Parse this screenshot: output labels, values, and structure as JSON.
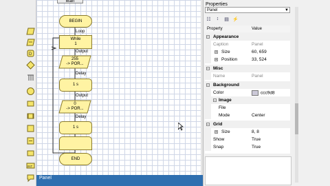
{
  "document_tab": "Main",
  "status_text": "Panel",
  "flowchart": {
    "begin": "BEGIN",
    "loop_label": "Loop",
    "while_line1": "While",
    "while_line2": "1",
    "output1_label": "Output",
    "output1_line1": "255",
    "output1_line2": "-> POR...",
    "delay1_label": "Delay",
    "delay1_value": "1 s",
    "output2_label": "Output",
    "output2_line1": "0",
    "output2_line2": "-> POR...",
    "delay2_label": "Delay",
    "delay2_value": "1 s",
    "end": "END"
  },
  "properties": {
    "title": "Properties",
    "selected_object": "Panel",
    "columns": {
      "property": "Property",
      "value": "Value"
    },
    "rows": [
      {
        "type": "cat",
        "name": "Appearance"
      },
      {
        "type": "field",
        "name": "Caption",
        "value": "Panel"
      },
      {
        "type": "sub",
        "name": "Size",
        "value": "60, 659"
      },
      {
        "type": "sub",
        "name": "Position",
        "value": "33, 524"
      },
      {
        "type": "cat",
        "name": "Misc"
      },
      {
        "type": "field",
        "name": "Name",
        "value": "Panel"
      },
      {
        "type": "cat",
        "name": "Background"
      },
      {
        "type": "field",
        "name": "Color",
        "value": "ccc9d8"
      },
      {
        "type": "cat2",
        "name": "Image"
      },
      {
        "type": "sub2",
        "name": "File",
        "value": ""
      },
      {
        "type": "sub2",
        "name": "Mode",
        "value": "Center"
      },
      {
        "type": "cat",
        "name": "Grid"
      },
      {
        "type": "sub",
        "name": "Size",
        "value": "8, 8"
      },
      {
        "type": "field",
        "name": "Show",
        "value": "True"
      },
      {
        "type": "field",
        "name": "Snap",
        "value": "True"
      }
    ]
  },
  "colors": {
    "flow_fill": "#fff3a3",
    "flow_stroke": "#8a7a2a",
    "status_bar": "#2f6fb0",
    "swatch": "#ccc9d8"
  }
}
